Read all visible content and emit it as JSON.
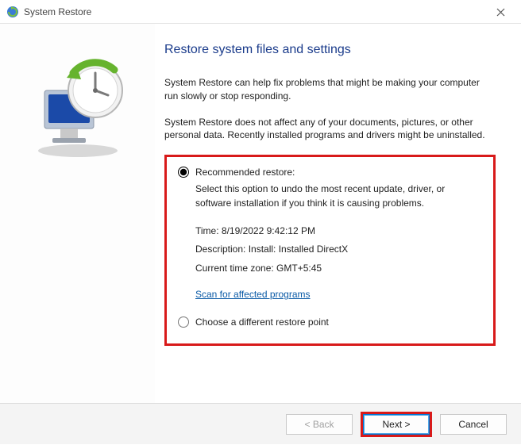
{
  "titlebar": {
    "title": "System Restore"
  },
  "main": {
    "heading": "Restore system files and settings",
    "intro1": "System Restore can help fix problems that might be making your computer run slowly or stop responding.",
    "intro2": "System Restore does not affect any of your documents, pictures, or other personal data. Recently installed programs and drivers might be uninstalled."
  },
  "options": {
    "recommended": {
      "label": "Recommended restore:",
      "desc": "Select this option to undo the most recent update, driver, or software installation if you think it is causing problems.",
      "time_label": "Time: ",
      "time_value": "8/19/2022 9:42:12 PM",
      "description_label": "Description: ",
      "description_value": "Install: Installed DirectX",
      "tz_label": "Current time zone: ",
      "tz_value": "GMT+5:45",
      "scan_link": "Scan for affected programs"
    },
    "different": {
      "label": "Choose a different restore point"
    }
  },
  "footer": {
    "back": "< Back",
    "next": "Next >",
    "cancel": "Cancel"
  }
}
